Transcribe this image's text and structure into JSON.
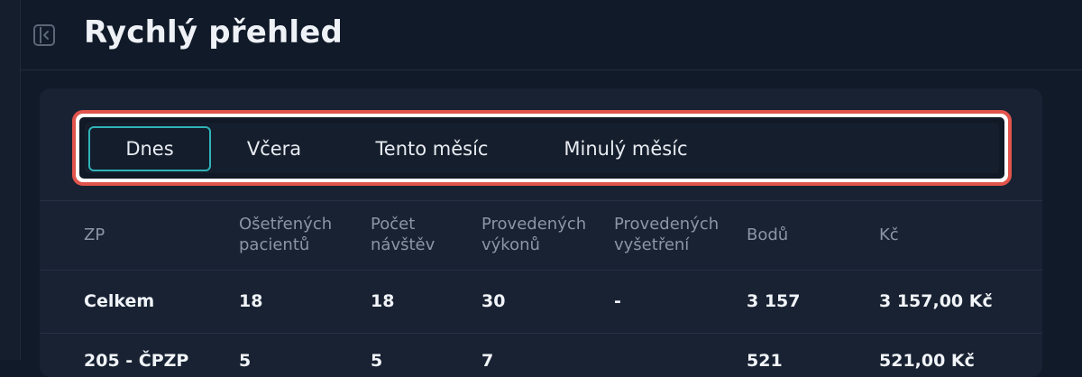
{
  "header": {
    "title": "Rychlý přehled"
  },
  "tabs": [
    {
      "label": "Dnes",
      "active": true
    },
    {
      "label": "Včera",
      "active": false
    },
    {
      "label": "Tento měsíc",
      "active": false
    },
    {
      "label": "Minulý měsíc",
      "active": false
    }
  ],
  "table": {
    "columns": [
      {
        "line1": "ZP",
        "line2": ""
      },
      {
        "line1": "Ošetřených",
        "line2": "pacientů"
      },
      {
        "line1": "Počet",
        "line2": "návštěv"
      },
      {
        "line1": "Provedených",
        "line2": "výkonů"
      },
      {
        "line1": "Provedených",
        "line2": "vyšetření"
      },
      {
        "line1": "Bodů",
        "line2": ""
      },
      {
        "line1": "Kč",
        "line2": ""
      }
    ],
    "rows": [
      [
        "Celkem",
        "18",
        "18",
        "30",
        "-",
        "3 157",
        "3 157,00 Kč"
      ],
      [
        "205 - ČPZP",
        "5",
        "5",
        "7",
        "",
        "521",
        "521,00 Kč"
      ]
    ]
  },
  "colors": {
    "background": "#111a29",
    "card": "#182233",
    "active_tab_border": "#2fb3b8",
    "highlight_outline": "#e0544c"
  },
  "icons": {
    "sidebar_toggle": "sidebar-collapse-icon"
  }
}
